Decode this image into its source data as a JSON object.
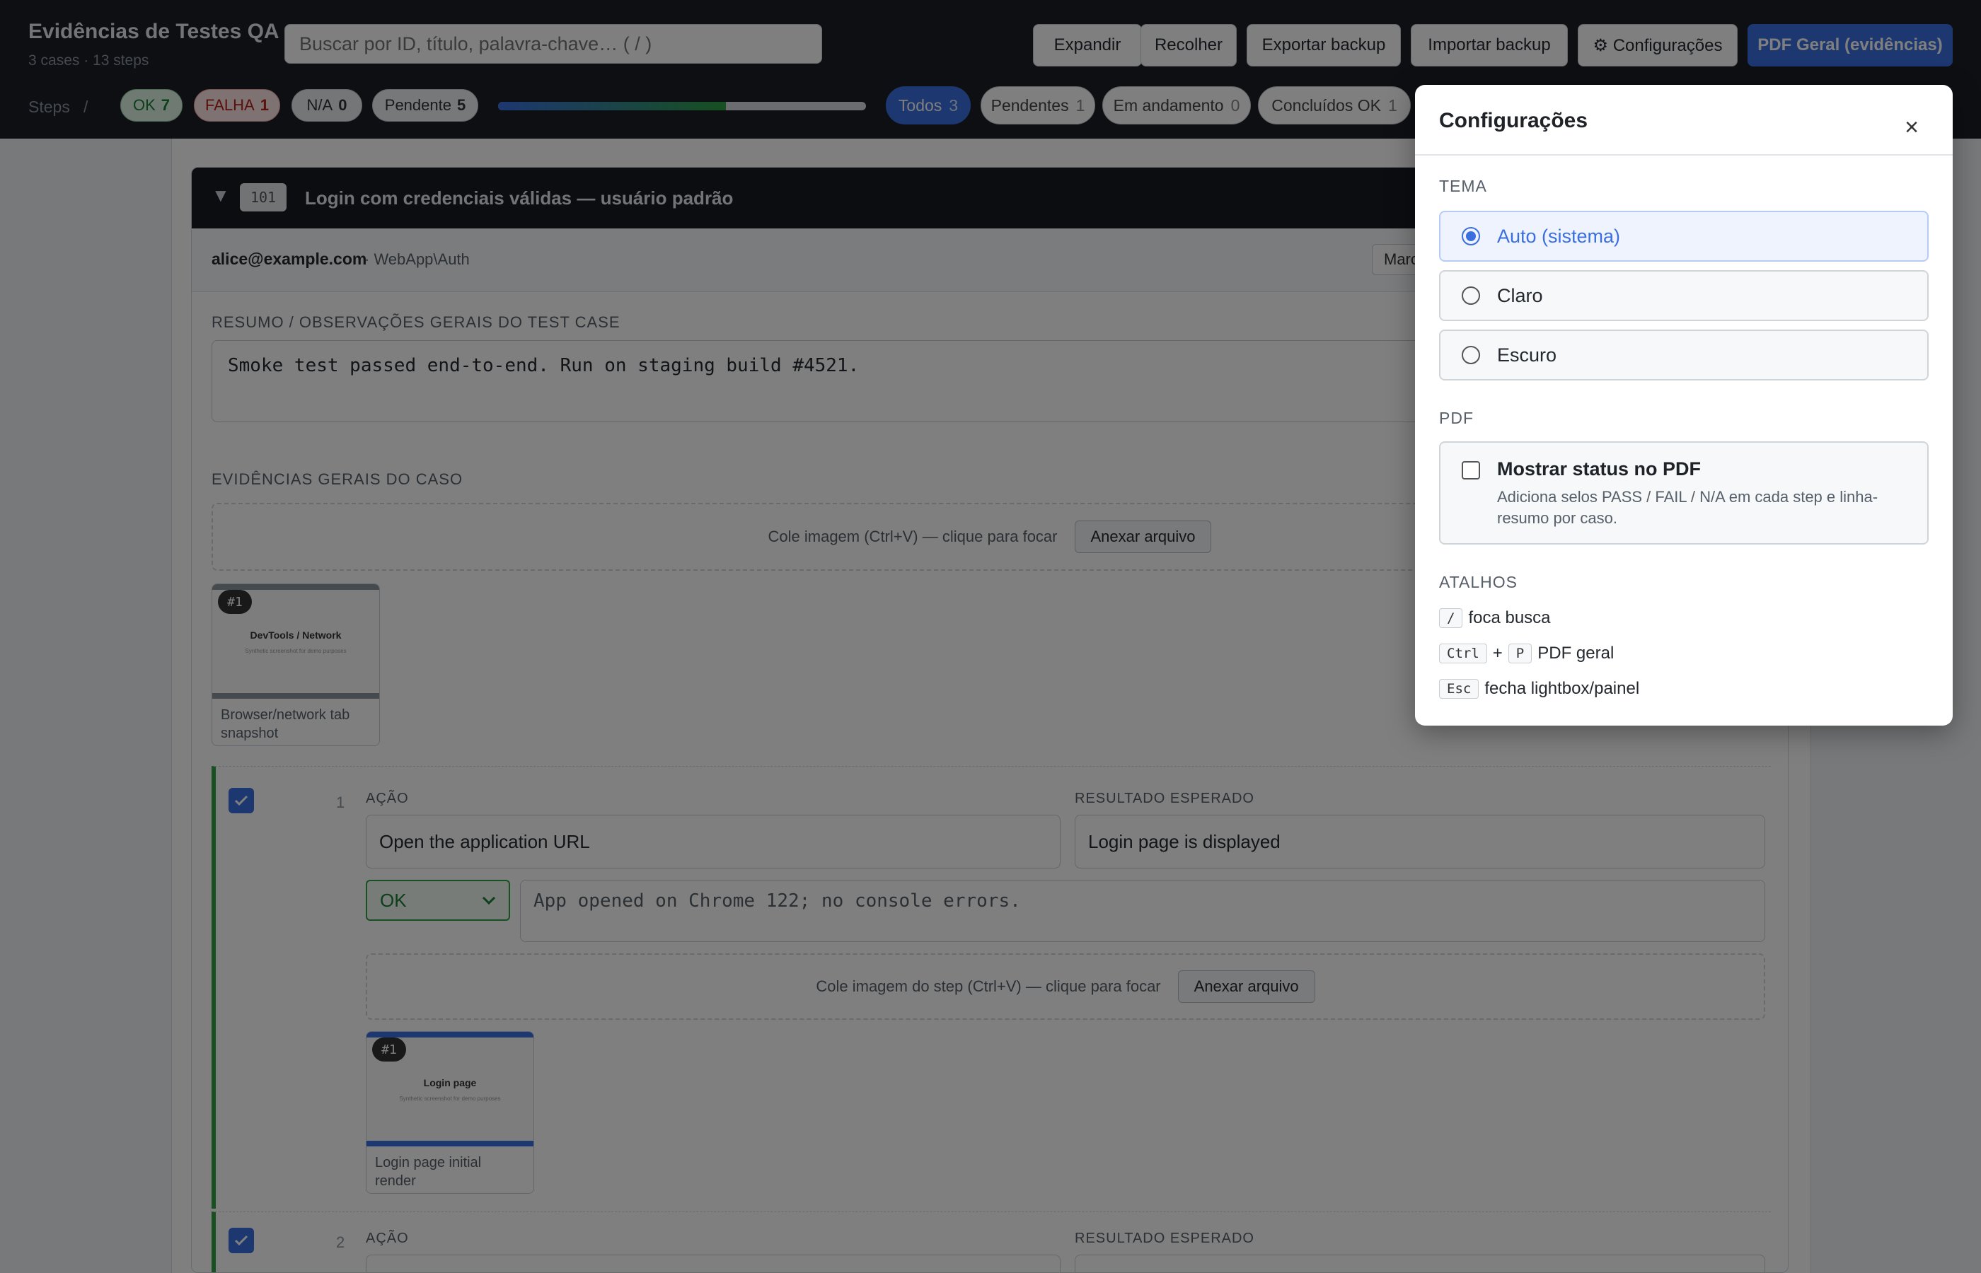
{
  "header": {
    "title": "Evidências de Testes QA",
    "subtitle": "3 cases · 13 steps",
    "search_placeholder": "Buscar por ID, título, palavra-chave… ( / )",
    "buttons": {
      "expand": "Expandir",
      "collapse": "Recolher",
      "export": "Exportar backup",
      "import": "Importar backup",
      "settings": "⚙ Configurações",
      "pdf": "PDF Geral (evidências)"
    },
    "steps_label": "Steps",
    "steps_sep": "/",
    "counts": {
      "ok_label": "OK",
      "ok": "7",
      "fail_label": "FALHA",
      "fail": "1",
      "na_label": "N/A",
      "na": "0",
      "pending_label": "Pendente",
      "pending": "5"
    },
    "progress_done_fraction": 0.62,
    "filters": [
      {
        "label": "Todos",
        "count": "3",
        "active": true
      },
      {
        "label": "Pendentes",
        "count": "1",
        "active": false
      },
      {
        "label": "Em andamento",
        "count": "0",
        "active": false
      },
      {
        "label": "Concluídos OK",
        "count": "1",
        "active": false
      }
    ]
  },
  "case": {
    "id": "101",
    "title": "Login com credenciais válidas — usuário padrão",
    "owner": "alice@example.com",
    "module": "· WebApp\\Auth",
    "mark_button": "Marcar",
    "summary_label": "Resumo / observações gerais do test case",
    "summary": "Smoke test passed end-to-end. Run on staging build #4521.",
    "evidence_label": "Evidências gerais do caso",
    "dropzone_text": "Cole imagem (Ctrl+V) — clique para focar",
    "attach_label": "Anexar arquivo",
    "evidence": {
      "badge": "#1",
      "thumb_title": "DevTools / Network",
      "thumb_sub": "Synthetic screenshot for demo purposes",
      "caption": "Browser/network tab snapshot"
    }
  },
  "steps": [
    {
      "number": "1",
      "action_label": "Ação",
      "action": "Open the application URL",
      "expected_label": "Resultado esperado",
      "expected": "Login page is displayed",
      "status": "OK",
      "notes": "App opened on Chrome 122; no console errors.",
      "dropzone_text": "Cole imagem do step (Ctrl+V) — clique para focar",
      "attach_label": "Anexar arquivo",
      "evidence": {
        "badge": "#1",
        "thumb_title": "Login page",
        "thumb_sub": "Synthetic screenshot for demo purposes",
        "caption": "Login page initial render"
      }
    },
    {
      "number": "2",
      "action_label": "Ação",
      "expected_label": "Resultado esperado"
    }
  ],
  "settings": {
    "title": "Configurações",
    "close": "×",
    "theme_label": "Tema",
    "theme_options": [
      "Auto (sistema)",
      "Claro",
      "Escuro"
    ],
    "theme_selected": "Auto (sistema)",
    "pdf_label": "PDF",
    "pdf_option_title": "Mostrar status no PDF",
    "pdf_option_desc": "Adiciona selos PASS / FAIL / N/A em cada step e linha-resumo por caso.",
    "pdf_option_checked": false,
    "shortcuts_label": "Atalhos",
    "shortcuts": {
      "s1_key": "/",
      "s1_desc": "foca busca",
      "s2_key1": "Ctrl",
      "s2_plus": "+",
      "s2_key2": "P",
      "s2_desc": "PDF geral",
      "s3_key": "Esc",
      "s3_desc": "fecha lightbox/painel"
    }
  },
  "colors": {
    "accent": "#3b6fe0",
    "ok": "#2ea043",
    "fail": "#b42318",
    "header_bg": "#1b1f26"
  }
}
